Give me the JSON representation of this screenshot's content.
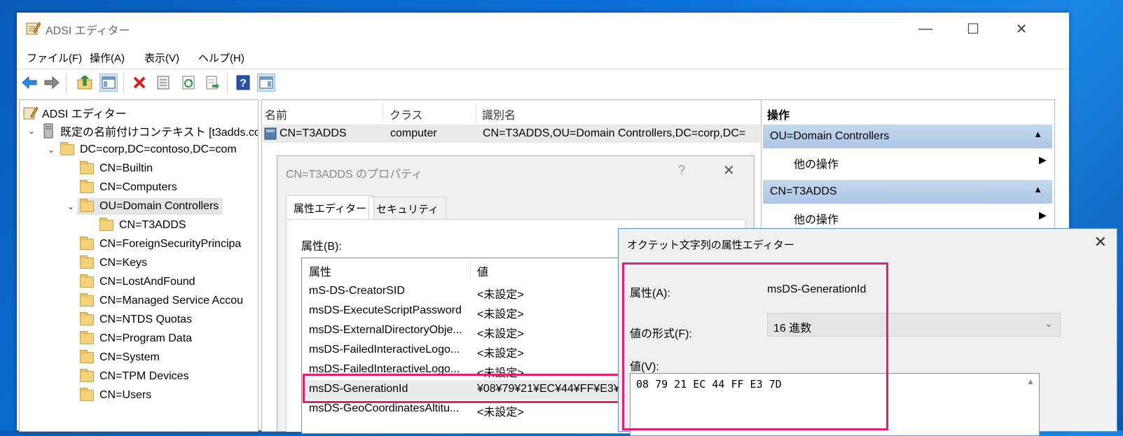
{
  "window": {
    "title": "ADSI エディター",
    "minimize": "—",
    "maximize": "☐",
    "close": "✕"
  },
  "menu": [
    "ファイル(F)",
    "操作(A)",
    "表示(V)",
    "ヘルプ(H)"
  ],
  "toolbar": {
    "icons": [
      "back-icon",
      "forward-icon",
      "up-folder-icon",
      "show-hide-tree-icon",
      "delete-icon",
      "properties-icon",
      "refresh-icon",
      "export-icon",
      "help-icon",
      "show-hide-action-icon"
    ]
  },
  "tree": {
    "root": "ADSI エディター",
    "context": "既定の名前付けコンテキスト [t3adds.co",
    "domain": "DC=corp,DC=contoso,DC=com",
    "items": [
      "CN=Builtin",
      "CN=Computers",
      "OU=Domain Controllers",
      "CN=T3ADDS",
      "CN=ForeignSecurityPrincipa",
      "CN=Keys",
      "CN=LostAndFound",
      "CN=Managed Service Accou",
      "CN=NTDS Quotas",
      "CN=Program Data",
      "CN=System",
      "CN=TPM Devices",
      "CN=Users"
    ]
  },
  "list": {
    "headers": [
      "名前",
      "クラス",
      "識別名"
    ],
    "row": {
      "name": "CN=T3ADDS",
      "class": "computer",
      "dn": "CN=T3ADDS,OU=Domain Controllers,DC=corp,DC="
    }
  },
  "actions": {
    "header": "操作",
    "sections": [
      {
        "title": "OU=Domain Controllers",
        "item": "他の操作"
      },
      {
        "title": "CN=T3ADDS",
        "item": "他の操作"
      }
    ]
  },
  "props_dialog": {
    "title": "CN=T3ADDS のプロパティ",
    "help": "?",
    "close": "✕",
    "tabs": [
      "属性エディター",
      "セキュリティ"
    ],
    "attr_label": "属性(B):",
    "table_headers": [
      "属性",
      "値"
    ],
    "rows": [
      {
        "name": "mS-DS-CreatorSID",
        "value": "<未設定>"
      },
      {
        "name": "msDS-ExecuteScriptPassword",
        "value": "<未設定>"
      },
      {
        "name": "msDS-ExternalDirectoryObje...",
        "value": "<未設定>"
      },
      {
        "name": "msDS-FailedInteractiveLogo...",
        "value": "<未設定>"
      },
      {
        "name": "msDS-FailedInteractiveLogo...",
        "value": "<未設定>"
      },
      {
        "name": "msDS-GenerationId",
        "value": "¥08¥79¥21¥EC¥44¥FF¥E3¥7D"
      },
      {
        "name": "msDS-GeoCoordinatesAltitu...",
        "value": "<未設定>"
      }
    ]
  },
  "octet_dialog": {
    "title": "オクテット文字列の属性エディター",
    "close": "✕",
    "attr_label": "属性(A):",
    "attr_value": "msDS-GenerationId",
    "format_label": "値の形式(F):",
    "format_value": "16 進数",
    "value_label": "値(V):",
    "value_text": "08 79 21 EC 44 FF E3 7D"
  },
  "colors": {
    "highlight": "#e0226e",
    "action_section": "#b6cfe8",
    "accent": "#0078d7"
  }
}
